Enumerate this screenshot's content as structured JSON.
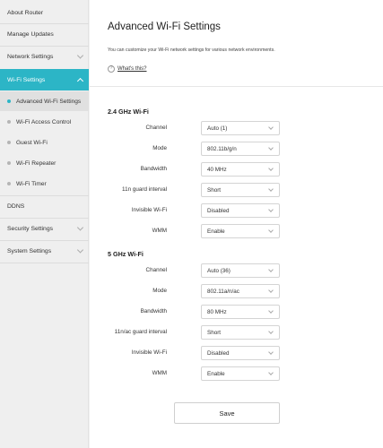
{
  "sidebar": {
    "about_router": "About Router",
    "manage_updates": "Manage Updates",
    "network_settings": "Network Settings",
    "wifi_settings": "Wi-Fi Settings",
    "sub_items": [
      "Advanced Wi-Fi Settings",
      "Wi-Fi Access Control",
      "Guest Wi-Fi",
      "Wi-Fi Repeater",
      "Wi-Fi Timer"
    ],
    "ddns": "DDNS",
    "security_settings": "Security Settings",
    "system_settings": "System Settings",
    "active_color": "#2cb5c6"
  },
  "main": {
    "title": "Advanced Wi-Fi Settings",
    "description": "You can customize your Wi-Fi network settings for various network environments.",
    "whats_this": "What's this?",
    "band_24": {
      "title": "2.4 GHz Wi-Fi",
      "rows": [
        {
          "label": "Channel",
          "value": "Auto (1)"
        },
        {
          "label": "Mode",
          "value": "802.11b/g/n"
        },
        {
          "label": "Bandwidth",
          "value": "40 MHz"
        },
        {
          "label": "11n guard interval",
          "value": "Short"
        },
        {
          "label": "Invisible Wi-Fi",
          "value": "Disabled"
        },
        {
          "label": "WMM",
          "value": "Enable"
        }
      ]
    },
    "band_5": {
      "title": "5 GHz Wi-Fi",
      "rows": [
        {
          "label": "Channel",
          "value": "Auto (36)"
        },
        {
          "label": "Mode",
          "value": "802.11a/n/ac"
        },
        {
          "label": "Bandwidth",
          "value": "80 MHz"
        },
        {
          "label": "11n/ac guard interval",
          "value": "Short"
        },
        {
          "label": "Invisible Wi-Fi",
          "value": "Disabled"
        },
        {
          "label": "WMM",
          "value": "Enable"
        }
      ]
    },
    "save_label": "Save"
  }
}
